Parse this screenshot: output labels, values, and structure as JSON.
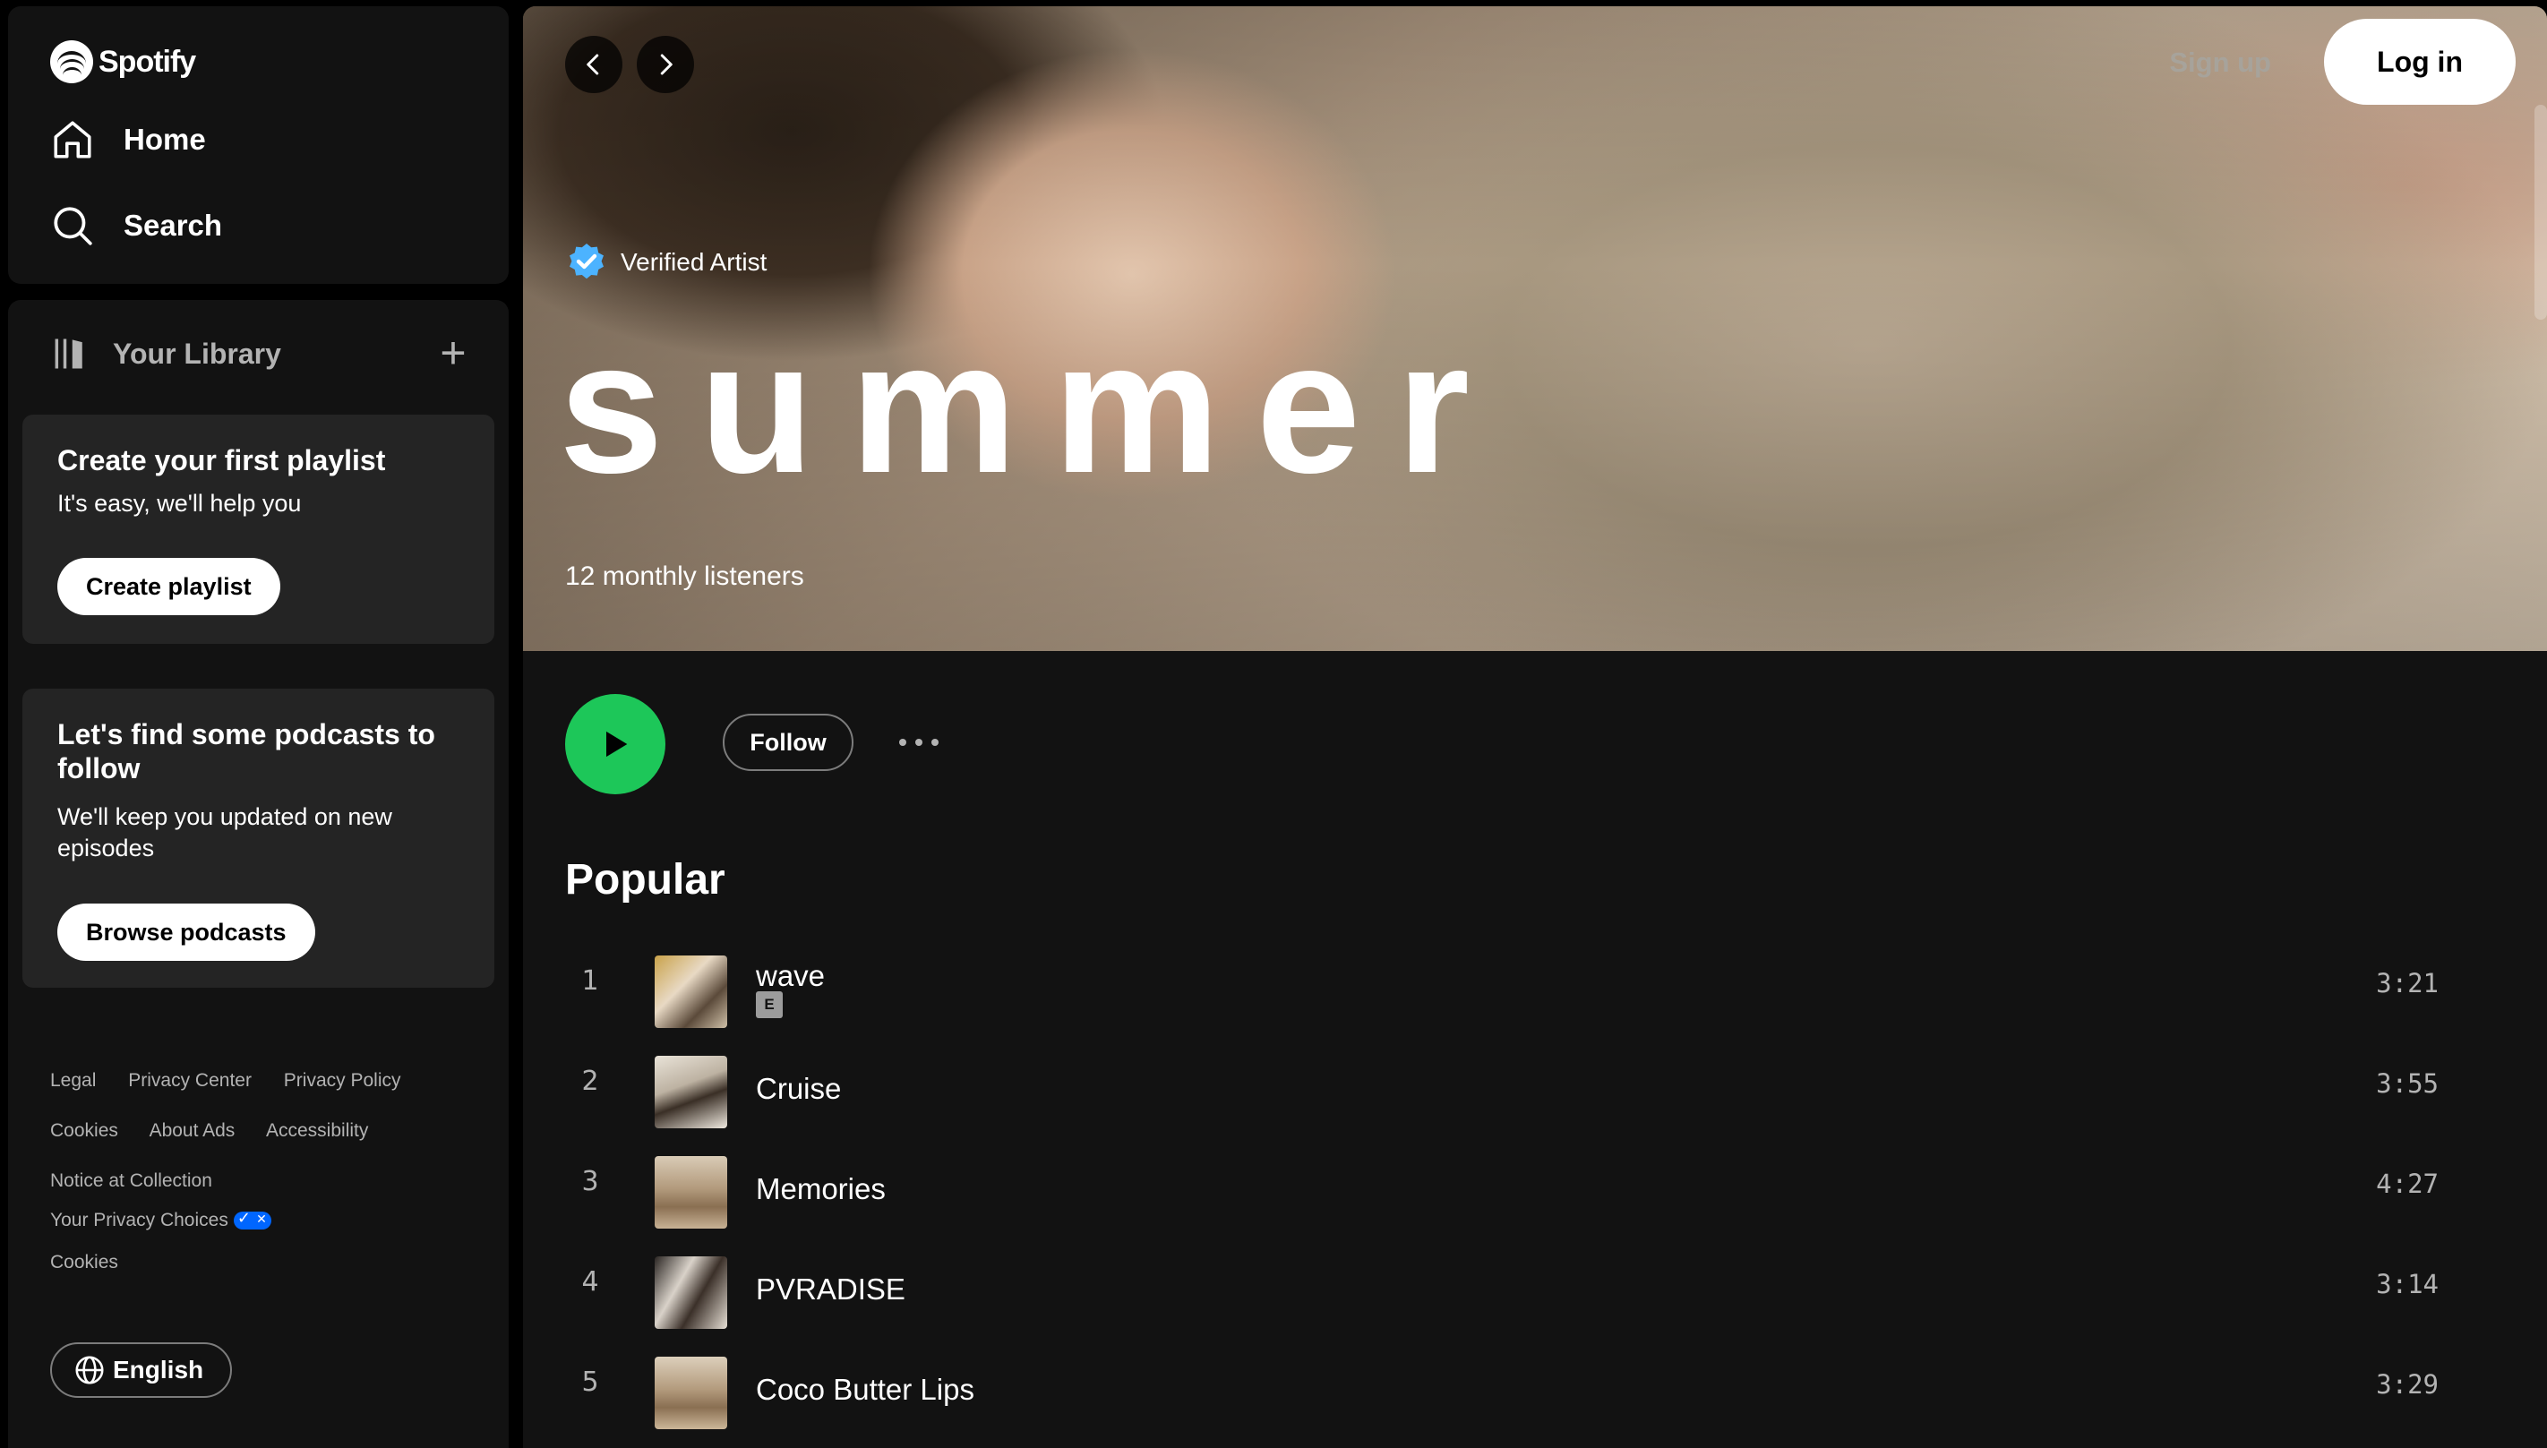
{
  "brand": {
    "name": "Spotify"
  },
  "nav": {
    "home_label": "Home",
    "search_label": "Search"
  },
  "library": {
    "title": "Your Library",
    "playlist_card": {
      "title": "Create your first playlist",
      "subtitle": "It's easy, we'll help you",
      "button": "Create playlist"
    },
    "podcast_card": {
      "title": "Let's find some podcasts to follow",
      "subtitle": "We'll keep you updated on new episodes",
      "button": "Browse podcasts"
    }
  },
  "footer": {
    "links_row1": [
      "Legal",
      "Privacy Center",
      "Privacy Policy"
    ],
    "links_row2": [
      "Cookies",
      "About Ads",
      "Accessibility"
    ],
    "links_row3": [
      "Notice at Collection"
    ],
    "privacy_choices": "Your Privacy Choices",
    "cookies": "Cookies",
    "language": "English"
  },
  "header": {
    "signup_label": "Sign up",
    "login_label": "Log in"
  },
  "artist": {
    "verified_label": "Verified Artist",
    "name": "summer",
    "monthly_listeners": "12 monthly listeners"
  },
  "actions": {
    "follow_label": "Follow"
  },
  "popular": {
    "title": "Popular",
    "tracks": [
      {
        "number": "1",
        "title": "wave",
        "explicit": "E",
        "duration": "3:21"
      },
      {
        "number": "2",
        "title": "Cruise",
        "duration": "3:55"
      },
      {
        "number": "3",
        "title": "Memories",
        "duration": "4:27"
      },
      {
        "number": "4",
        "title": "PVRADISE",
        "duration": "3:14"
      },
      {
        "number": "5",
        "title": "Coco Butter Lips",
        "duration": "3:29"
      }
    ]
  },
  "colors": {
    "accent_green": "#1ed760",
    "sidebar_bg": "#121212",
    "card_bg": "#242424",
    "privacy_badge": "#0066ff"
  },
  "icons": [
    "spotify-logo-icon",
    "home-icon",
    "search-icon",
    "library-icon",
    "plus-icon",
    "globe-icon",
    "back-icon",
    "forward-icon",
    "verified-badge-icon",
    "play-icon",
    "more-icon"
  ]
}
